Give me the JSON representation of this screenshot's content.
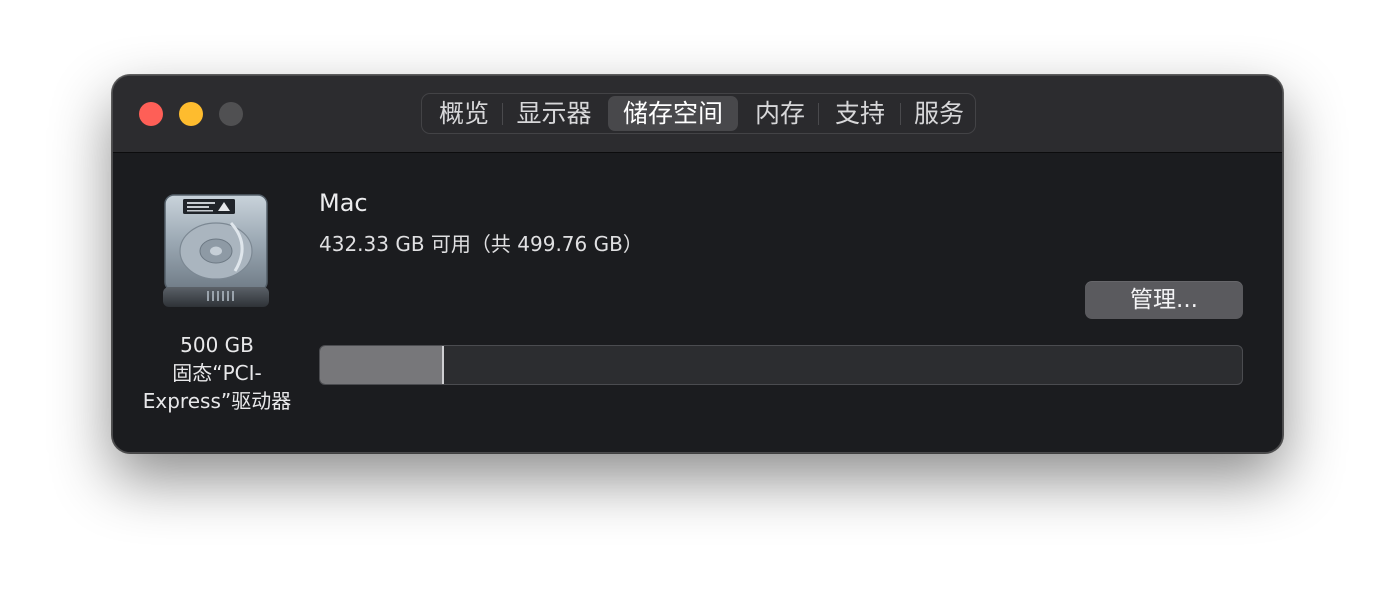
{
  "tabs": [
    {
      "label": "概览",
      "selected": false
    },
    {
      "label": "显示器",
      "selected": false
    },
    {
      "label": "储存空间",
      "selected": true
    },
    {
      "label": "内存",
      "selected": false
    },
    {
      "label": "支持",
      "selected": false
    },
    {
      "label": "服务",
      "selected": false
    }
  ],
  "drive": {
    "icon": "hard-drive-icon",
    "capacity": "500 GB",
    "type_line1": "固态“PCI-",
    "type_line2": "Express”驱动器"
  },
  "volume": {
    "name": "Mac",
    "info": "432.33 GB 可用（共 499.76 GB）",
    "used_fraction": 0.135
  },
  "actions": {
    "manage_label": "管理..."
  },
  "colors": {
    "close": "#fe5f57",
    "minimize": "#febc2e",
    "zoom": "#505052",
    "window_bg": "#1b1c1f",
    "bar_used": "#77777a"
  }
}
